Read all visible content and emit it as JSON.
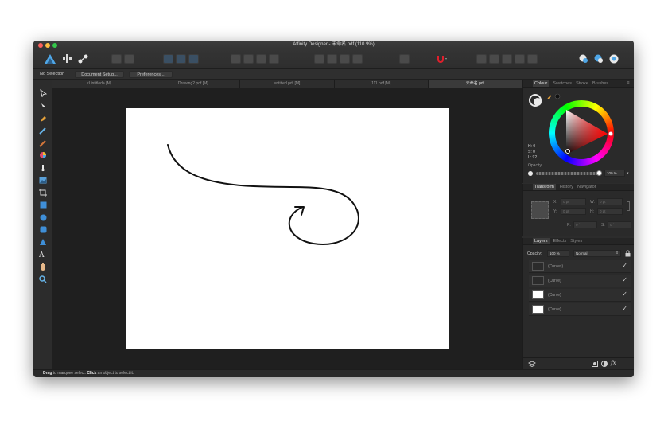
{
  "window": {
    "title": "Affinity Designer - 未命名.pdf (110.9%)"
  },
  "context_bar": {
    "selection_label": "No Selection",
    "document_setup_label": "Document Setup...",
    "preferences_label": "Preferences..."
  },
  "document_tabs": [
    {
      "label": "<Untitled> [M]"
    },
    {
      "label": "Drawing2.pdf [M]"
    },
    {
      "label": "untitled.pdf [M]"
    },
    {
      "label": "111.pdf [M]"
    },
    {
      "label": "未命名.pdf"
    }
  ],
  "colour_panel": {
    "tabs": [
      "Colour",
      "Swatches",
      "Stroke",
      "Brushes"
    ],
    "h_label": "H: 0",
    "s_label": "S: 0",
    "l_label": "L: 92",
    "opacity_label": "Opacity",
    "opacity_value": "100 %"
  },
  "transform_panel": {
    "tabs": [
      "Transform",
      "History",
      "Navigator"
    ],
    "x_label": "X:",
    "x_value": "0 pt",
    "y_label": "Y:",
    "y_value": "0 pt",
    "w_label": "W:",
    "w_value": "0 pt",
    "h_label": "H:",
    "h_value": "0 pt",
    "r_label": "R:",
    "r_value": "0 °",
    "s_label": "S:",
    "s_value": "0 °"
  },
  "layers_panel": {
    "tabs": [
      "Layers",
      "Effects",
      "Styles"
    ],
    "opacity_label": "Opacity:",
    "opacity_value": "100 %",
    "blend_mode": "Normal",
    "layers": [
      {
        "name": "(Curves)",
        "thumb": "dark"
      },
      {
        "name": "(Curve)",
        "thumb": "dark"
      },
      {
        "name": "(Curve)",
        "thumb": "white"
      },
      {
        "name": "(Curve)",
        "thumb": "white"
      }
    ]
  },
  "status_bar": {
    "drag_word": "Drag",
    "drag_text": " to marquee select. ",
    "click_word": "Click",
    "click_text": " an object to select it."
  },
  "colors": {
    "accent_red": "#e01f2c",
    "canvas_bg": "#1f1f1f",
    "ui_bg": "#2c2c2c"
  }
}
